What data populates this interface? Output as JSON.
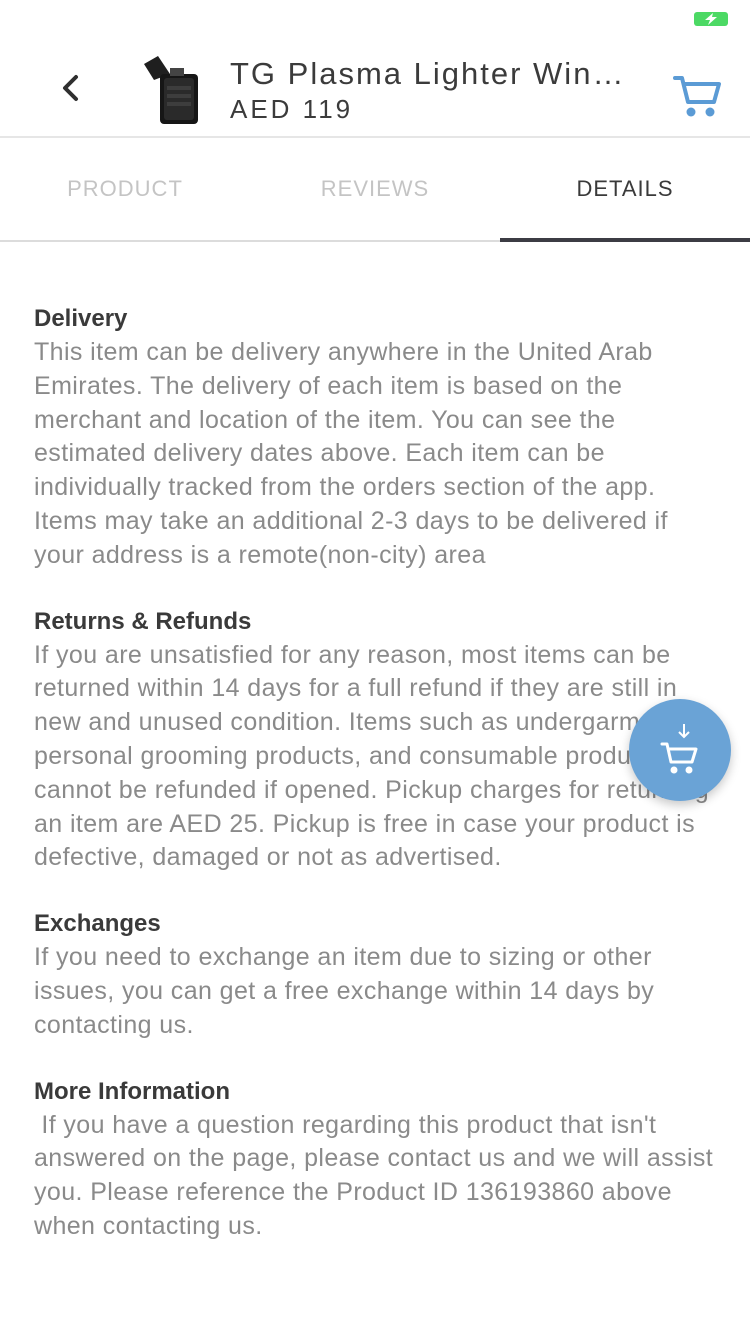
{
  "status_bar": {
    "battery_icon": "battery-charging-icon",
    "battery_color": "#4cd964"
  },
  "header": {
    "back_icon": "chevron-left-icon",
    "product_title": "TG Plasma Lighter Windproof...",
    "price": "AED 119",
    "cart_icon": "cart-icon",
    "accent_color": "#5b9bd5"
  },
  "tabs": [
    {
      "label": "PRODUCT",
      "active": false
    },
    {
      "label": "REVIEWS",
      "active": false
    },
    {
      "label": "DETAILS",
      "active": true
    }
  ],
  "sections": [
    {
      "title": "Delivery",
      "body": "This item can be delivery anywhere in the United Arab Emirates. The delivery of each item is based on the merchant and location of the item. You can see the estimated delivery dates above. Each item can be individually tracked from the orders section of the app. Items may take an additional 2-3 days to be delivered if your address is a remote(non-city) area"
    },
    {
      "title": "Returns & Refunds",
      "body": "If you are unsatisfied for any reason, most items can be returned within 14 days for a full refund if they are still in new and unused condition. Items such as undergarments, personal grooming products, and consumable products cannot be refunded if opened. Pickup charges for returning an item are AED 25. Pickup is free in case your product is defective, damaged or not as advertised."
    },
    {
      "title": "Exchanges",
      "body": "If you need to exchange an item due to sizing or other issues, you can get a free exchange within 14 days by contacting us."
    },
    {
      "title": "More Information",
      "body": " If you have a question regarding this product that isn't answered on the page, please contact us and we will assist you. Please reference the Product ID 136193860 above when contacting us."
    }
  ],
  "fab": {
    "icon": "add-to-cart-icon",
    "color": "#6aa3d6"
  }
}
